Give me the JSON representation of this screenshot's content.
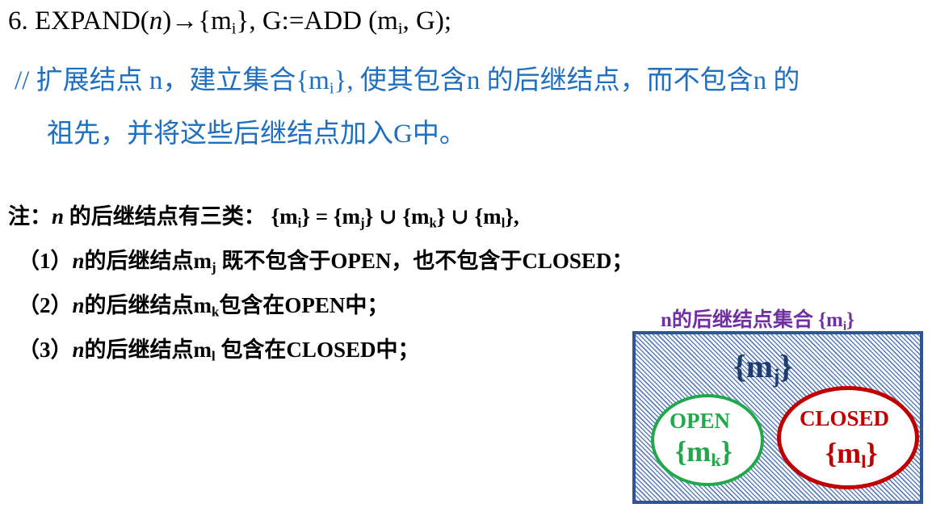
{
  "line1": {
    "prefix": "6. EXPAND(",
    "n": "n",
    "arrow_open": ")→{m",
    "sub_i": "i",
    "mid": "}, G:=ADD (m",
    "sub_i2": "i",
    "end": ", G);"
  },
  "line2": {
    "comment": "// ",
    "text_a": "扩展结点 n，建立集合{m",
    "sub_i": "i",
    "text_b": "}, 使其包含n 的后继结点，而不包含n 的"
  },
  "line3": {
    "text": "祖先，并将这些后继结点加入G中。"
  },
  "notes": {
    "note0": {
      "prefix": "注：",
      "n": "n",
      "text": " 的后继结点有三类：  {m",
      "sub_i": "i",
      "eq": "} = {m",
      "sub_j": "j",
      "u1": "} ∪ {m",
      "sub_k": "k",
      "u2": "} ∪ {m",
      "sub_l": "l",
      "end": "},"
    },
    "note1": {
      "num": "（1）",
      "n": "n",
      "text_a": "的后继结点m",
      "sub": "j",
      "text_b": " 既不包含于OPEN，也不包含于CLOSED；"
    },
    "note2": {
      "num": "（2）",
      "n": "n",
      "text_a": "的后继结点m",
      "sub": "k",
      "text_b": "包含在OPEN中；"
    },
    "note3": {
      "num": "（3）",
      "n": "n",
      "text_a": "的后继结点m",
      "sub": "l",
      "text_b": " 包含在CLOSED中；"
    }
  },
  "diagram": {
    "title_a": "n的后继结点集合 {m",
    "title_sub": "i",
    "title_b": "}",
    "mj_a": "{m",
    "mj_sub": "j",
    "mj_b": "}",
    "open_label": "OPEN",
    "mk_a": "{m",
    "mk_sub": "k",
    "mk_b": "}",
    "closed_label": "CLOSED",
    "ml_a": "{m",
    "ml_sub": "l",
    "ml_b": "}",
    "colors": {
      "box_border": "#2f5597",
      "title": "#7030a0",
      "open": "#21a84a",
      "closed": "#c00000",
      "comment": "#1f6fc0"
    }
  }
}
